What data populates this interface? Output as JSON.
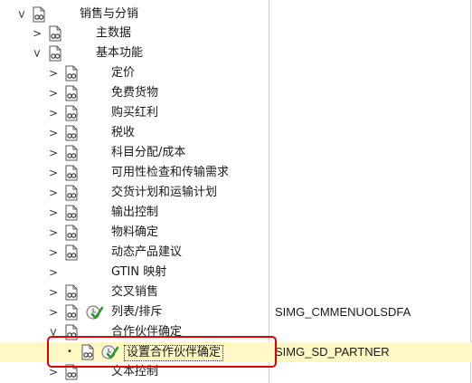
{
  "tree": {
    "rows": [
      {
        "label": "销售与分销",
        "code": ""
      },
      {
        "label": "主数据",
        "code": ""
      },
      {
        "label": "基本功能",
        "code": ""
      },
      {
        "label": "定价",
        "code": ""
      },
      {
        "label": "免费货物",
        "code": ""
      },
      {
        "label": "购买红利",
        "code": ""
      },
      {
        "label": "税收",
        "code": ""
      },
      {
        "label": "科目分配/成本",
        "code": ""
      },
      {
        "label": "可用性检查和传输需求",
        "code": ""
      },
      {
        "label": "交货计划和运输计划",
        "code": ""
      },
      {
        "label": "输出控制",
        "code": ""
      },
      {
        "label": "物料确定",
        "code": ""
      },
      {
        "label": "动态产品建议",
        "code": ""
      },
      {
        "label": "GTIN 映射",
        "code": ""
      },
      {
        "label": "交叉销售",
        "code": ""
      },
      {
        "label": "列表/排斥",
        "code": "SIMG_CMMENUOLSDFA"
      },
      {
        "label": "合作伙伴确定",
        "code": ""
      },
      {
        "label": "设置合作伙伴确定",
        "code": "SIMG_SD_PARTNER"
      },
      {
        "label": "文本控制",
        "code": ""
      }
    ]
  }
}
